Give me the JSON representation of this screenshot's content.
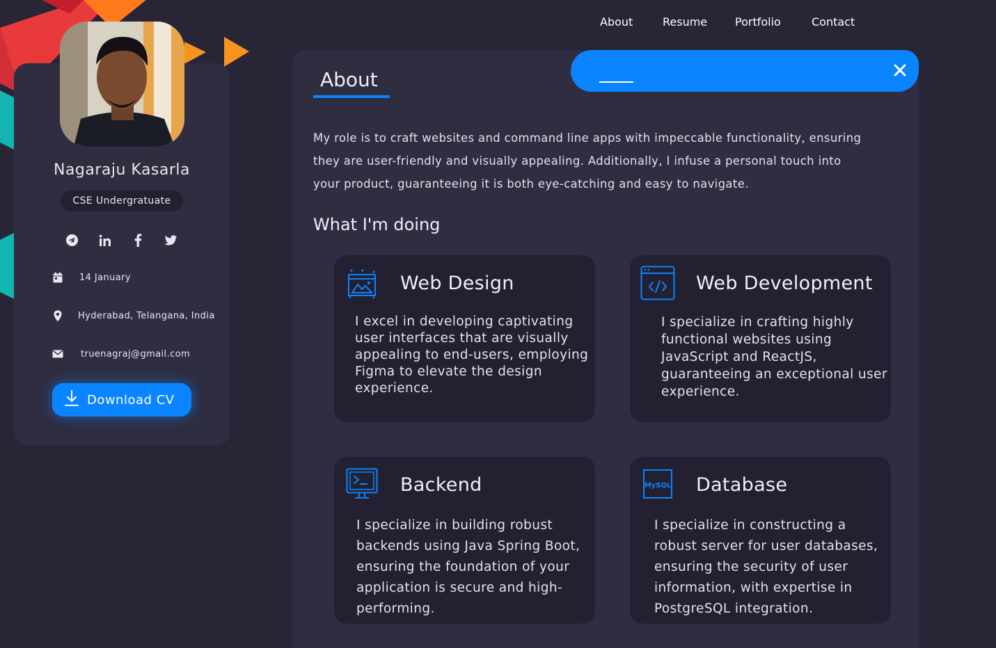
{
  "colors": {
    "accent": "#0b84ff",
    "background": "#272536",
    "panel": "#2f2d40",
    "card": "#232131"
  },
  "profile": {
    "name": "Nagaraju Kasarla",
    "role": "CSE Undergratuate",
    "socials": [
      "telegram-icon",
      "linkedin-icon",
      "facebook-icon",
      "twitter-icon"
    ],
    "birthday": "14 January",
    "location": "Hyderabad, Telangana, India",
    "email": "truenagraj@gmail.com",
    "download_label": "Download CV"
  },
  "nav": {
    "items": [
      "About",
      "Resume",
      "Portfolio",
      "Contact"
    ],
    "active": "About"
  },
  "about": {
    "title": "About",
    "text": "My role is to craft websites and command line apps with impeccable functionality, ensuring they are user-friendly and visually appealing. Additionally, I infuse a personal touch into your product, guaranteeing it is both eye-catching and easy to navigate."
  },
  "doing": {
    "title": "What I'm doing",
    "services": [
      {
        "title": "Web Design",
        "icon": "design-icon",
        "text": "I excel in developing captivating user interfaces that are visually appealing to end-users, employing Figma to elevate the design experience."
      },
      {
        "title": "Web Development",
        "icon": "code-icon",
        "text": "I specialize in crafting highly functional websites using JavaScript and ReactJS, guaranteeing an exceptional user experience."
      },
      {
        "title": "Backend",
        "icon": "terminal-icon",
        "text": "I specialize in building robust backends using Java Spring Boot, ensuring the foundation of your application is secure and high-performing."
      },
      {
        "title": "Database",
        "icon": "mysql-icon",
        "icon_label": "MySQL",
        "text": "I specialize in constructing a robust server for user databases, ensuring the security of user information, with expertise in PostgreSQL integration."
      }
    ]
  }
}
